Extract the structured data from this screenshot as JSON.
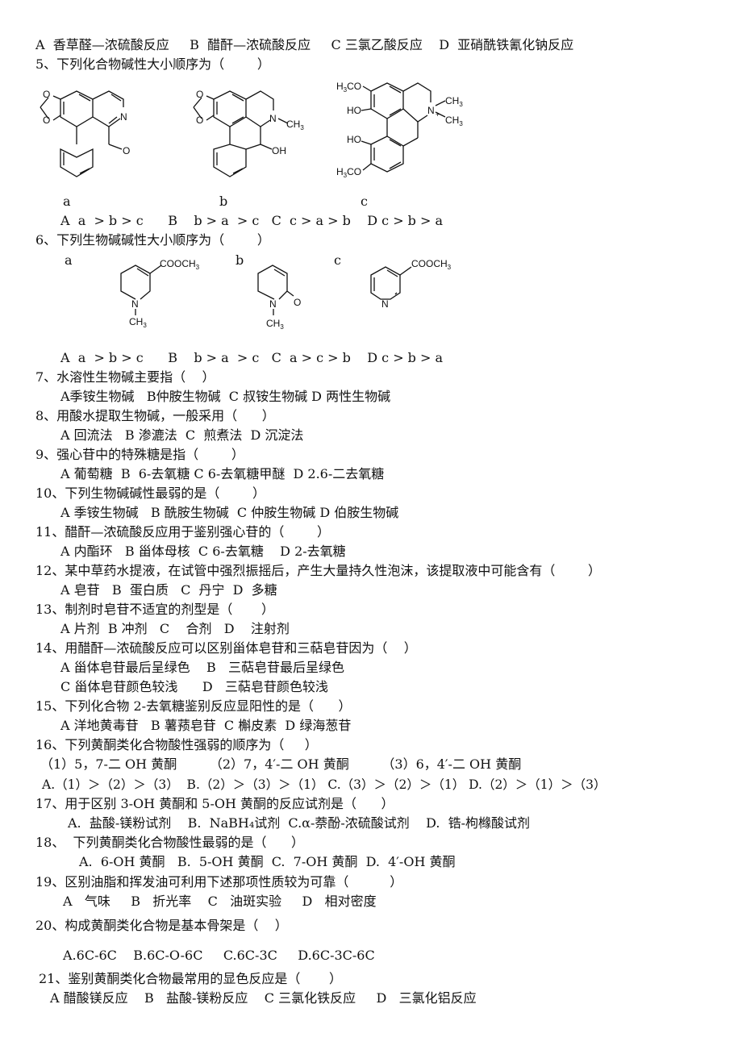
{
  "lines": {
    "q4_options": "A  香草醛—浓硫酸反应     B  醋酐—浓硫酸反应     C 三氯乙酸反应    D  亚硝酰铁氰化钠反应",
    "q5_stem": "5、下列化合物碱性大小顺序为（        ）",
    "q5_label_a": "a",
    "q5_label_b": "b",
    "q5_label_c": "c",
    "q5_options": "A  a  > b > c      B    b > a  > c   C  c > a > b    D c > b > a",
    "q6_stem": "6、下列生物碱碱性大小顺序为（        ）",
    "q6_label_a": "a",
    "q6_label_b": "b",
    "q6_label_c": "c",
    "q6_options": "A  a  > b > c      B    b > a  > c   C  a > c > b    D c > b > a",
    "q7_stem": "7、水溶性生物碱主要指（    ）",
    "q7_options": "A季铵生物碱   B仲胺生物碱  C 叔铵生物碱 D 两性生物碱",
    "q8_stem": "8、用酸水提取生物碱，一般采用（      ）",
    "q8_options": "A 回流法   B 渗漉法  C  煎煮法  D 沉淀法",
    "q9_stem": "9、强心苷中的特殊糖是指（        ）",
    "q9_options": "A 葡萄糖  B  6-去氧糖 C 6-去氧糖甲醚  D 2.6-二去氧糖",
    "q10_stem": "10、下列生物碱碱性最弱的是（        ）",
    "q10_options": "A 季铵生物碱   B 酰胺生物碱  C 仲胺生物碱 D 伯胺生物碱",
    "q11_stem": "11、醋酐—浓硫酸反应用于鉴别强心苷的（        ）",
    "q11_options": "A 内酯环   B 甾体母核  C 6-去氧糖    D 2-去氧糖",
    "q12_stem": "12、某中草药水提液，在试管中强烈振摇后，产生大量持久性泡沫，该提取液中可能含有（        ）",
    "q12_options": "A 皂苷   B  蛋白质   C  丹宁  D  多糖",
    "q13_stem": "13、制剂时皂苷不适宜的剂型是（       ）",
    "q13_options": "A 片剂  B 冲剂   C    合剂   D    注射剂",
    "q14_stem": "14、用醋酐—浓硫酸反应可以区别甾体皂苷和三萜皂苷因为（    ）",
    "q14_options_1": "A 甾体皂苷最后呈绿色    B   三萜皂苷最后呈绿色",
    "q14_options_2": "C 甾体皂苷颜色较浅      D   三萜皂苷颜色较浅",
    "q15_stem": "15、下列化合物 2-去氧糖鉴别反应显阳性的是（      ）",
    "q15_options": "A 洋地黄毒苷   B 薯蓣皂苷  C 槲皮素  D 绿海葱苷",
    "q16_stem": "16、下列黄酮类化合物酸性强弱的顺序为（     ）",
    "q16_items": "（1）5，7-二 OH 黄酮        （2）7，4′-二 OH 黄酮        （3）6，4′-二 OH 黄酮",
    "q16_options": "A.（1）＞（2）＞（3）  B.（2）＞（3）＞（1） C.（3）＞（2）＞（1） D.（2）＞（1）＞（3）",
    "q17_stem": "17、用于区别 3-OH 黄酮和 5-OH 黄酮的反应试剂是（      ）",
    "q17_options": "A.  盐酸-镁粉试剂    B.  NaBH₄试剂  C.α-萘酚-浓硫酸试剂    D.  锆-枸橼酸试剂",
    "q18_stem": "18、  下列黄酮类化合物酸性最弱的是（      ）",
    "q18_options": "A.  6-OH 黄酮   B.  5-OH 黄酮  C.  7-OH 黄酮  D.  4′-OH 黄酮",
    "q19_stem": "19、区别油脂和挥发油可利用下述那项性质较为可靠（          ）",
    "q19_options": "A   气味     B   折光率    C   油斑实验     D   相对密度",
    "q20_stem": "20、构成黄酮类化合物是基本骨架是（    ）",
    "q20_options": "A.6C-6C    B.6C-O-6C     C.6C-3C     D.6C-3C-6C",
    "q21_stem": "21、鉴别黄酮类化合物最常用的显色反应是（       ）",
    "q21_options": "A 醋酸镁反应    B   盐酸-镁粉反应    C 三氯化铁反应     D   三氯化铝反应"
  },
  "structures": {
    "q5_a": {
      "atoms": [
        "O",
        "O",
        "N",
        "O"
      ]
    },
    "q5_b": {
      "atoms": [
        "O",
        "O",
        "N",
        "CH3",
        "OH"
      ]
    },
    "q5_c": {
      "atoms": [
        "H3CO",
        "HO",
        "HO",
        "H3CO",
        "N+",
        "CH3",
        "CH3"
      ]
    },
    "q6_a": {
      "atoms": [
        "COOCH3",
        "N",
        "CH3"
      ]
    },
    "q6_b": {
      "atoms": [
        "N",
        "O",
        "CH3"
      ]
    },
    "q6_c": {
      "atoms": [
        "COOCH3",
        "N"
      ]
    }
  }
}
